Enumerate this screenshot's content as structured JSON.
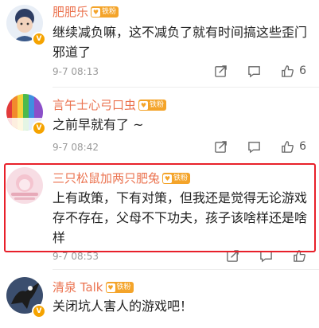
{
  "comments": [
    {
      "username": "肥肥乐",
      "badge": "铁粉",
      "text_lines": [
        "继续减负嘛，这不减负了就有时间搞这些歪门",
        "邪道了"
      ],
      "time": "9-7 08:13",
      "likes": "6",
      "verified": true
    },
    {
      "username": "言午士心弓口虫",
      "badge": "铁粉",
      "text_lines": [
        "之前早就有了 ~"
      ],
      "time": "9-7 08:42",
      "likes": "6",
      "verified": true
    },
    {
      "username": "三只松鼠加两只肥兔",
      "badge": "铁粉",
      "text_lines": [
        "上有政策，下有对策，但我还是觉得无论游戏",
        "存不存在，父母不下功夫，孩子该啥样还是啥",
        "样"
      ],
      "time": "9-7 08:53",
      "likes": "",
      "verified": false,
      "highlighted": true
    },
    {
      "username": "清泉 Talk",
      "badge": "铁粉",
      "text_lines": [
        "关闭坑人害人的游戏吧！"
      ],
      "time": "",
      "likes": "",
      "verified": true
    }
  ],
  "colors": {
    "username": "#eb7350",
    "highlight_border": "#e8202a",
    "badge": "#f4a42a"
  },
  "icons": [
    "share-icon",
    "comment-icon",
    "like-icon",
    "verified-v-icon",
    "heart-badge-icon"
  ]
}
